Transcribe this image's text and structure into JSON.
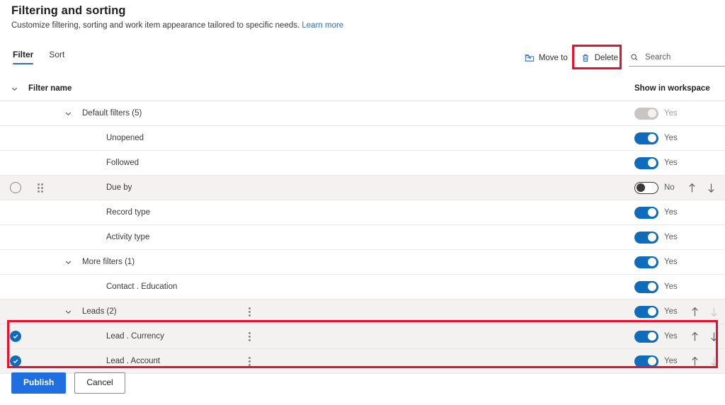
{
  "header": {
    "title": "Filtering and sorting",
    "subtitle": "Customize filtering, sorting and work item appearance tailored to specific needs.",
    "learn_more": "Learn more"
  },
  "tabs": [
    {
      "label": "Filter",
      "active": true
    },
    {
      "label": "Sort",
      "active": false
    }
  ],
  "toolbar": {
    "move_to": "Move to",
    "delete": "Delete",
    "search_placeholder": "Search",
    "search_value": ""
  },
  "table": {
    "columns": {
      "filter_name": "Filter name",
      "show_in_workspace": "Show in workspace"
    },
    "rows": [
      {
        "name": "Default filters (5)",
        "indent": "group",
        "chevron": true,
        "toggle": "disabled",
        "toggle_label": "Yes",
        "shaded": false,
        "checkbox": "none",
        "drag": false,
        "kebab": false,
        "arrows": "none"
      },
      {
        "name": "Unopened",
        "indent": "item",
        "chevron": false,
        "toggle": "on",
        "toggle_label": "Yes",
        "shaded": false,
        "checkbox": "none",
        "drag": false,
        "kebab": false,
        "arrows": "none"
      },
      {
        "name": "Followed",
        "indent": "item",
        "chevron": false,
        "toggle": "on",
        "toggle_label": "Yes",
        "shaded": false,
        "checkbox": "none",
        "drag": false,
        "kebab": false,
        "arrows": "none"
      },
      {
        "name": "Due by",
        "indent": "item",
        "chevron": false,
        "toggle": "off",
        "toggle_label": "No",
        "shaded": true,
        "checkbox": "unchecked",
        "drag": true,
        "kebab": false,
        "arrows": "both"
      },
      {
        "name": "Record type",
        "indent": "item",
        "chevron": false,
        "toggle": "on",
        "toggle_label": "Yes",
        "shaded": false,
        "checkbox": "none",
        "drag": false,
        "kebab": false,
        "arrows": "none"
      },
      {
        "name": "Activity type",
        "indent": "item",
        "chevron": false,
        "toggle": "on",
        "toggle_label": "Yes",
        "shaded": false,
        "checkbox": "none",
        "drag": false,
        "kebab": false,
        "arrows": "none"
      },
      {
        "name": "More filters (1)",
        "indent": "group",
        "chevron": true,
        "toggle": "on",
        "toggle_label": "Yes",
        "shaded": false,
        "checkbox": "none",
        "drag": false,
        "kebab": false,
        "arrows": "none"
      },
      {
        "name": "Contact . Education",
        "indent": "item",
        "chevron": false,
        "toggle": "on",
        "toggle_label": "Yes",
        "shaded": false,
        "checkbox": "none",
        "drag": false,
        "kebab": false,
        "arrows": "none"
      },
      {
        "name": "Leads (2)",
        "indent": "group",
        "chevron": true,
        "toggle": "on",
        "toggle_label": "Yes",
        "shaded": true,
        "checkbox": "none",
        "drag": false,
        "kebab": true,
        "arrows": "up-active"
      },
      {
        "name": "Lead . Currency",
        "indent": "item",
        "chevron": false,
        "toggle": "on",
        "toggle_label": "Yes",
        "shaded": true,
        "checkbox": "checked",
        "drag": false,
        "kebab": true,
        "arrows": "both"
      },
      {
        "name": "Lead . Account",
        "indent": "item",
        "chevron": false,
        "toggle": "on",
        "toggle_label": "Yes",
        "shaded": true,
        "checkbox": "checked",
        "drag": false,
        "kebab": true,
        "arrows": "up-active"
      }
    ]
  },
  "footer": {
    "publish": "Publish",
    "cancel": "Cancel"
  },
  "colors": {
    "accent": "#0f6cbd",
    "link": "#2b6fc9",
    "primary_button": "#1f6fe0",
    "highlight": "#e8112d",
    "row_shaded": "#f3f2f1"
  }
}
